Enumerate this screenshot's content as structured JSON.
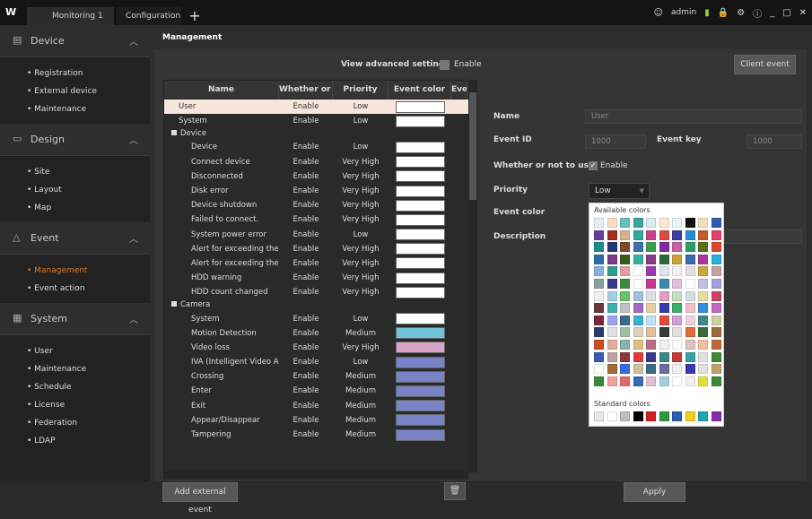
{
  "topbar": {
    "logo": "W",
    "tabs": [
      "Monitoring 1",
      "Configuration"
    ],
    "add_tab": "+",
    "user": "admin",
    "icons": [
      "user-icon",
      "alarm-icon",
      "lock-icon",
      "settings-icon",
      "info-icon",
      "minimize-icon",
      "maximize-icon",
      "close-icon"
    ]
  },
  "sidebar": {
    "sections": [
      {
        "label": "Device",
        "icon": "device-icon",
        "items": [
          "Registration",
          "External device",
          "Maintenance"
        ]
      },
      {
        "label": "Design",
        "icon": "design-icon",
        "items": [
          "Site",
          "Layout",
          "Map"
        ]
      },
      {
        "label": "Event",
        "icon": "bell-icon",
        "items": [
          "Management",
          "Event action"
        ],
        "active": "Management"
      },
      {
        "label": "System",
        "icon": "system-icon",
        "items": [
          "User",
          "Maintenance",
          "Schedule",
          "License",
          "Federation",
          "LDAP"
        ]
      }
    ]
  },
  "main": {
    "title": "Management",
    "view_advanced": "View advanced settings",
    "enable": "Enable",
    "client_event": "Client event",
    "add_external": "Add external event",
    "apply": "Apply"
  },
  "table": {
    "headers": [
      "Name",
      "Whether or not",
      "Priority",
      "Event color",
      "Eve"
    ],
    "rows": [
      {
        "type": "row",
        "name": "User",
        "use": "Enable",
        "priority": "Low",
        "color": "#ffffff",
        "selected": true
      },
      {
        "type": "row",
        "name": "System",
        "use": "Enable",
        "priority": "Low",
        "color": "#ffffff"
      },
      {
        "type": "group",
        "name": "Device"
      },
      {
        "type": "child",
        "name": "Device",
        "use": "Enable",
        "priority": "Low",
        "color": "#ffffff"
      },
      {
        "type": "child",
        "name": "Connect device",
        "use": "Enable",
        "priority": "Very High",
        "color": "#ffffff"
      },
      {
        "type": "child",
        "name": "Disconnected",
        "use": "Enable",
        "priority": "Very High",
        "color": "#ffffff"
      },
      {
        "type": "child",
        "name": "Disk error",
        "use": "Enable",
        "priority": "Very High",
        "color": "#ffffff"
      },
      {
        "type": "child",
        "name": "Device shutdown",
        "use": "Enable",
        "priority": "Very High",
        "color": "#ffffff"
      },
      {
        "type": "child",
        "name": "Failed to connect.",
        "use": "Enable",
        "priority": "Very High",
        "color": "#ffffff"
      },
      {
        "type": "child",
        "name": "System power error",
        "use": "Enable",
        "priority": "Low",
        "color": "#ffffff"
      },
      {
        "type": "child",
        "name": "Alert for exceeding the t",
        "use": "Enable",
        "priority": "Very High",
        "color": "#ffffff"
      },
      {
        "type": "child",
        "name": "Alert for exceeding the r",
        "use": "Enable",
        "priority": "Very High",
        "color": "#ffffff"
      },
      {
        "type": "child",
        "name": "HDD warning",
        "use": "Enable",
        "priority": "Very High",
        "color": "#ffffff"
      },
      {
        "type": "child",
        "name": "HDD count changed",
        "use": "Enable",
        "priority": "Very High",
        "color": "#ffffff"
      },
      {
        "type": "group",
        "name": "Camera"
      },
      {
        "type": "child",
        "name": "System",
        "use": "Enable",
        "priority": "Low",
        "color": "#ffffff"
      },
      {
        "type": "child",
        "name": "Motion Detection",
        "use": "Enable",
        "priority": "Medium",
        "color": "#6ec3d8"
      },
      {
        "type": "child",
        "name": "Video loss",
        "use": "Enable",
        "priority": "Very High",
        "color": "#d8a6c7"
      },
      {
        "type": "child",
        "name": "IVA (Intelligent Video An",
        "use": "Enable",
        "priority": "Low",
        "color": "#7983c6"
      },
      {
        "type": "child",
        "name": "Crossing",
        "use": "Enable",
        "priority": "Medium",
        "color": "#7983c6"
      },
      {
        "type": "child",
        "name": "Enter",
        "use": "Enable",
        "priority": "Medium",
        "color": "#7983c6"
      },
      {
        "type": "child",
        "name": "Exit",
        "use": "Enable",
        "priority": "Medium",
        "color": "#7983c6"
      },
      {
        "type": "child",
        "name": "Appear/Disappear",
        "use": "Enable",
        "priority": "Medium",
        "color": "#7983c6"
      },
      {
        "type": "child",
        "name": "Tampering",
        "use": "Enable",
        "priority": "Medium",
        "color": "#7983c6"
      }
    ]
  },
  "form": {
    "name_label": "Name",
    "name_value": "User",
    "event_id_label": "Event ID",
    "event_id_value": "1000",
    "event_key_label": "Event key",
    "event_key_value": "1000",
    "use_label": "Whether or not to use",
    "use_value": "Enable",
    "priority_label": "Priority",
    "priority_value": "Low",
    "color_label": "Event color",
    "desc_label": "Description"
  },
  "picker": {
    "available_label": "Available colors",
    "standard_label": "Standard colors",
    "available": [
      "#e5f0f6",
      "#f6dcc3",
      "#64c1bf",
      "#3aa6a0",
      "#d7ebef",
      "#fbe9d0",
      "#e8f6fb",
      "#111111",
      "#f6dcc3",
      "#2a5fb0",
      "#6a3d9a",
      "#a0301f",
      "#d5b28c",
      "#36a59a",
      "#c9418a",
      "#e24a3c",
      "#3b3f9e",
      "#2b8bd0",
      "#c25a2a",
      "#e0416a",
      "#1a8c8c",
      "#1f3a78",
      "#7a4a2a",
      "#3f6ea8",
      "#3a9e4f",
      "#7d2a9e",
      "#c65fa0",
      "#2a9e6a",
      "#5a6f1c",
      "#d94a2a",
      "#2a6ea8",
      "#7a3a8a",
      "#3a5a1a",
      "#3ab0a0",
      "#8a3a8a",
      "#2a6a3a",
      "#c8a03a",
      "#3a6ab0",
      "#a83a9e",
      "#2ab0e0",
      "#8ab0e0",
      "#2a9e8a",
      "#e0a0a0",
      "#ffffff",
      "#9e3ab0",
      "#e0e0f0",
      "#f0f0f0",
      "#e0e0e0",
      "#c8a83a",
      "#c8a0a0",
      "#8aa0a0",
      "#3a3a8a",
      "#3a8a3a",
      "#ffffff",
      "#c83a8a",
      "#3a8ab0",
      "#e0c0e0",
      "#ffffff",
      "#c0c0e0",
      "#a0a0e0",
      "#f0f0f0",
      "#a0d0e0",
      "#6ac06a",
      "#a0c0e0",
      "#e0e0e0",
      "#e0a0c0",
      "#c0e0c0",
      "#d0e0e0",
      "#e0e0a0",
      "#d04060",
      "#6a3a3a",
      "#3ab0b0",
      "#c0c0c0",
      "#a06ac0",
      "#e0d0a0",
      "#3a3ab0",
      "#3ab06a",
      "#f0c0c0",
      "#3a8ae0",
      "#c06ac0",
      "#7a2a3a",
      "#a0a0f0",
      "#3a6a8a",
      "#3ab0d0",
      "#c0e0f0",
      "#e04a3a",
      "#d0a0d0",
      "#f0d0e0",
      "#3a8a8a",
      "#d0d0a0",
      "#2a3a6a",
      "#e0e0e0",
      "#a0c0a0",
      "#e0d0c0",
      "#e0c0a0",
      "#3a3a3a",
      "#e0e0e0",
      "#e06a3a",
      "#3a6a3a",
      "#a06a3a",
      "#d04a1a",
      "#e0b0a0",
      "#8ab0b0",
      "#e0c080",
      "#c06a8a",
      "#f0f0f0",
      "#ffffff",
      "#e0c0c0",
      "#f0c0a0",
      "#c06a3a",
      "#3a5ab0",
      "#c0a0a0",
      "#8a3a3a",
      "#e03a3a",
      "#3a3a8a",
      "#3a8a8a",
      "#c03a3a",
      "#3aa0a0",
      "#e0e0e0",
      "#3a8a3a",
      "#ffffff",
      "#a06a3a",
      "#3a6ae0",
      "#d0c0a0",
      "#3a6a8a",
      "#6a6aa0",
      "#f0f0f0",
      "#3a3ab0",
      "#e0e0e0",
      "#c0a06a",
      "#3a8a3a",
      "#f0a0a0",
      "#e06a6a",
      "#3a6ab0",
      "#e0c0d0",
      "#a0d0e0",
      "#ffffff",
      "#f0f0f0",
      "#e0e03a",
      "#3a8a3a"
    ],
    "standard": [
      "#e8e8e8",
      "#ffffff",
      "#bfbfbf",
      "#000000",
      "#d32020",
      "#2a9a3a",
      "#2a5fb0",
      "#f0d020",
      "#1fa6b0",
      "#8a2ab0"
    ]
  }
}
